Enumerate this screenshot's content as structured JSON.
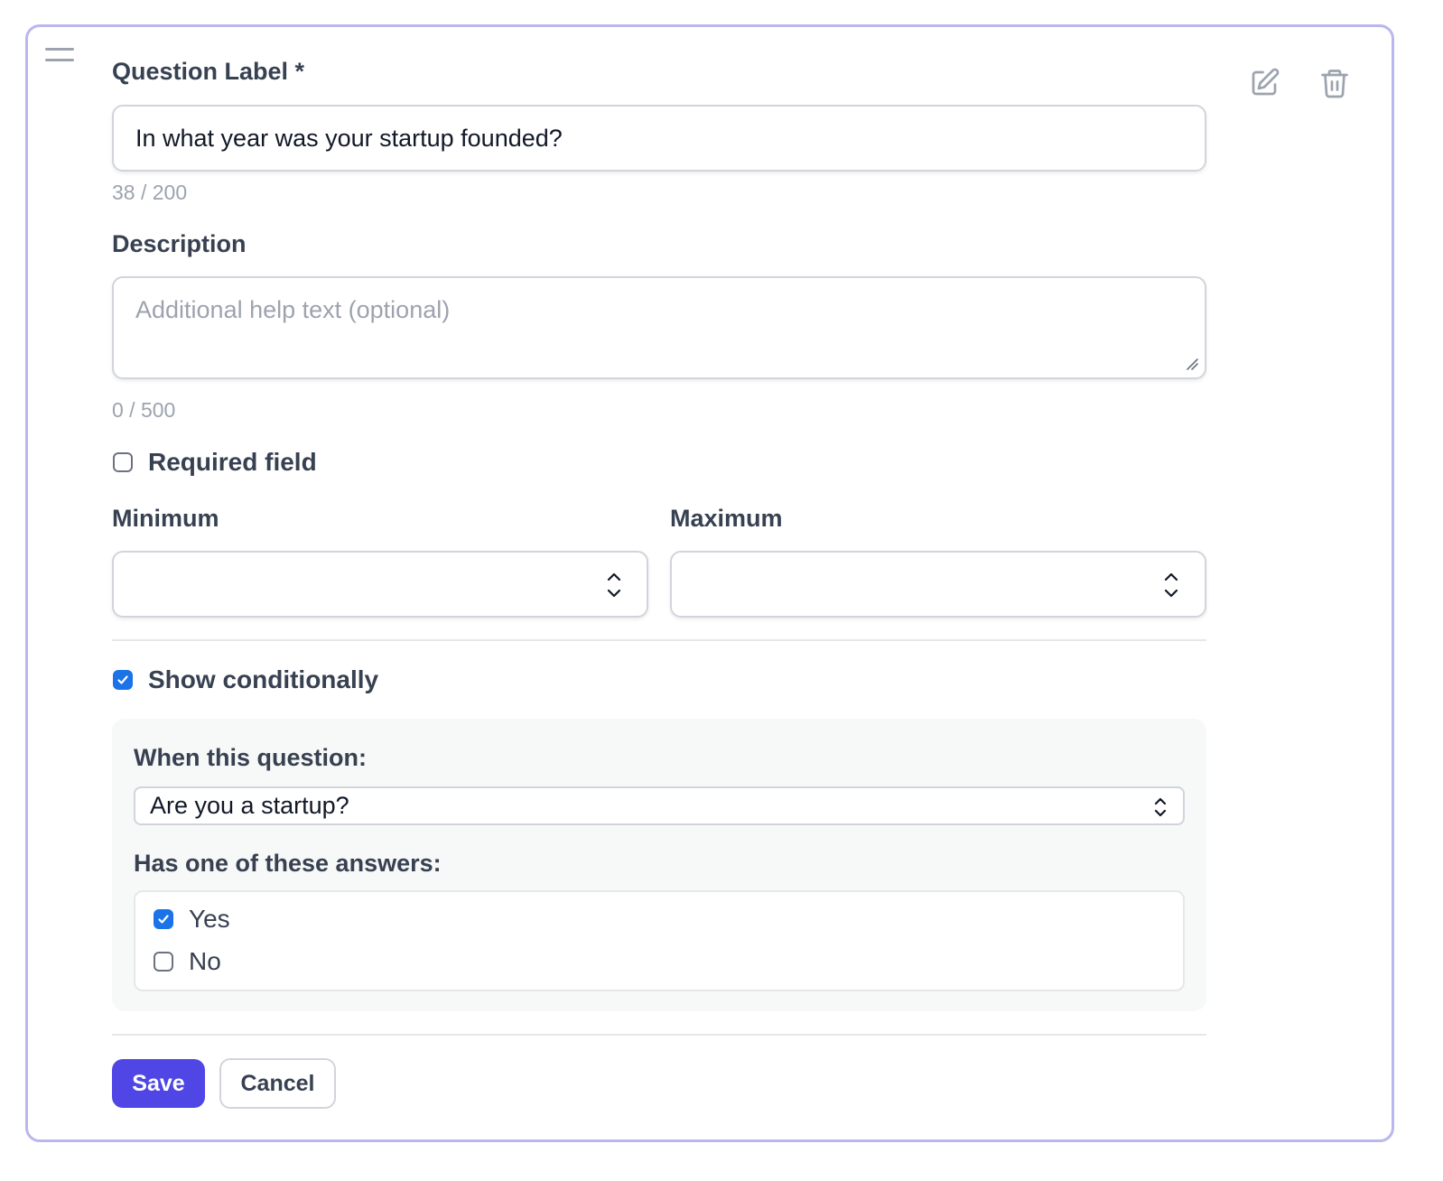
{
  "question_label": {
    "label": "Question Label *",
    "value": "In what year was your startup founded?",
    "counter": "38 / 200"
  },
  "description": {
    "label": "Description",
    "placeholder": "Additional help text (optional)",
    "counter": "0 / 500"
  },
  "required_field": {
    "label": "Required field",
    "checked": false
  },
  "minimum": {
    "label": "Minimum",
    "value": ""
  },
  "maximum": {
    "label": "Maximum",
    "value": ""
  },
  "show_conditionally": {
    "label": "Show conditionally",
    "checked": true
  },
  "condition": {
    "question_label": "When this question:",
    "selected_question": "Are you a startup?",
    "answers_label": "Has one of these answers:",
    "answers": [
      {
        "label": "Yes",
        "checked": true
      },
      {
        "label": "No",
        "checked": false
      }
    ]
  },
  "actions": {
    "save": "Save",
    "cancel": "Cancel"
  },
  "icons": {
    "drag": "drag-handle-icon",
    "edit": "edit-icon",
    "delete": "trash-icon",
    "stepper": "chevron-up-down-icon",
    "check": "checkmark-icon"
  },
  "colors": {
    "card_border": "#b9b7ee",
    "primary": "#5046e5",
    "checkbox_checked": "#1a73e8",
    "panel_bg": "#f7f8f8"
  }
}
